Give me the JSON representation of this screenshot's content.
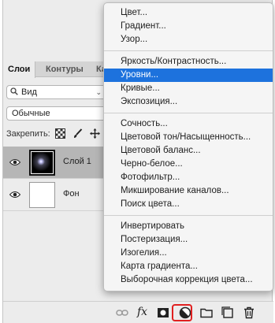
{
  "tabs": [
    "Слои",
    "Контуры",
    "Ка"
  ],
  "filter": {
    "label": "Вид"
  },
  "blend_mode": "Обычные",
  "lock_label": "Закрепить:",
  "layers": [
    {
      "name": "Слой 1",
      "selected": true
    },
    {
      "name": "Фон",
      "selected": false
    }
  ],
  "menu": {
    "groups": [
      [
        "Цвет...",
        "Градиент...",
        "Узор..."
      ],
      [
        "Яркость/Контрастность...",
        "Уровни...",
        "Кривые...",
        "Экспозиция..."
      ],
      [
        "Сочность...",
        "Цветовой тон/Насыщенность...",
        "Цветовой баланс...",
        "Черно-белое...",
        "Фотофильтр...",
        "Микширование каналов...",
        "Поиск цвета..."
      ],
      [
        "Инвертировать",
        "Постеризация...",
        "Изогелия...",
        "Карта градиента...",
        "Выборочная коррекция цвета..."
      ]
    ],
    "active_item": "Уровни..."
  },
  "bottom_bar": {
    "fx_label": "fx",
    "icons": [
      "link-icon",
      "fx-icon",
      "mask-icon",
      "adjustment-layer-icon",
      "folder-icon",
      "new-layer-icon",
      "trash-icon"
    ]
  },
  "colors": {
    "menu_highlight": "#1d72dd",
    "callout_border": "#e02020"
  }
}
